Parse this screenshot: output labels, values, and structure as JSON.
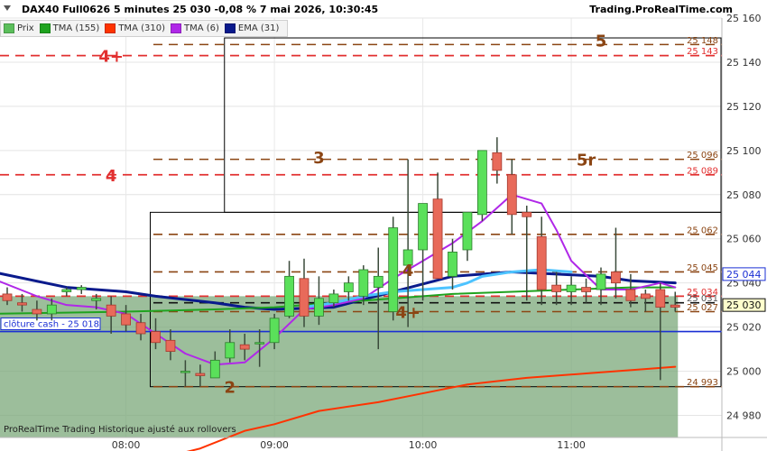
{
  "header": {
    "title": "DAX40 Full0626 5 minutes 25 030 -0,08 % 7 mai 2026, 10:30:45",
    "source": "Trading.ProRealTime.com"
  },
  "legend": [
    {
      "label": "Prix",
      "color": "#5bbf5b"
    },
    {
      "label": "TMA (155)",
      "color": "#1fa31f"
    },
    {
      "label": "TMA (310)",
      "color": "#ff3300"
    },
    {
      "label": "TMA (6)",
      "color": "#b028e8"
    },
    {
      "label": "EMA (31)",
      "color": "#0a1a8c"
    }
  ],
  "watermark": "ProRealTime Trading  Historique ajusté aux rollovers",
  "chart_data": {
    "type": "candlestick",
    "ylim": [
      24970,
      25160
    ],
    "y_ticks": [
      24980,
      25000,
      25020,
      25040,
      25060,
      25080,
      25100,
      25120,
      25140,
      25160
    ],
    "y_tick_labels": [
      "24 980",
      "25 000",
      "25 020",
      "25 040",
      "25 060",
      "25 080",
      "25 100",
      "25 120",
      "25 140",
      "25 160"
    ],
    "x_range": [
      0,
      50
    ],
    "x_ticks": [
      {
        "x": 8,
        "label": "08:00"
      },
      {
        "x": 18,
        "label": "09:00"
      },
      {
        "x": 28,
        "label": "10:00"
      },
      {
        "x": 38,
        "label": "11:00"
      }
    ],
    "candles": [
      [
        0,
        25035,
        25038,
        25030,
        25032
      ],
      [
        1,
        25031,
        25035,
        25027,
        25030
      ],
      [
        2,
        25028,
        25032,
        25023,
        25026
      ],
      [
        3,
        25026,
        25033,
        25023,
        25030
      ],
      [
        4,
        25036,
        25038,
        25034,
        25037
      ],
      [
        5,
        25037,
        25039,
        25035,
        25038
      ],
      [
        6,
        25032,
        25035,
        25028,
        25033
      ],
      [
        7,
        25030,
        25034,
        25017,
        25025
      ],
      [
        8,
        25026,
        25030,
        25018,
        25021
      ],
      [
        9,
        25022,
        25026,
        25014,
        25017
      ],
      [
        10,
        25018,
        25024,
        25010,
        25013
      ],
      [
        11,
        25014,
        25019,
        25005,
        25009
      ],
      [
        12,
        25000,
        25005,
        24993,
        25000
      ],
      [
        13,
        24999,
        25003,
        24993,
        24998
      ],
      [
        14,
        24997,
        25009,
        24997,
        25005
      ],
      [
        15,
        25006,
        25019,
        25004,
        25013
      ],
      [
        16,
        25012,
        25017,
        25005,
        25010
      ],
      [
        17,
        25013,
        25019,
        25002,
        25013
      ],
      [
        18,
        25013,
        25026,
        25010,
        25024
      ],
      [
        19,
        25025,
        25050,
        25024,
        25043
      ],
      [
        20,
        25042,
        25051,
        25020,
        25025
      ],
      [
        21,
        25025,
        25043,
        25021,
        25033
      ],
      [
        22,
        25031,
        25037,
        25029,
        25035
      ],
      [
        23,
        25036,
        25043,
        25032,
        25040
      ],
      [
        24,
        25034,
        25048,
        25030,
        25046
      ],
      [
        25,
        25038,
        25056,
        25010,
        25043
      ],
      [
        26,
        25027,
        25070,
        25023,
        25065
      ],
      [
        27,
        25048,
        25096,
        25020,
        25055
      ],
      [
        28,
        25055,
        25075,
        25032,
        25076
      ],
      [
        29,
        25078,
        25090,
        25055,
        25042
      ],
      [
        30,
        25043,
        25060,
        25037,
        25054
      ],
      [
        31,
        25055,
        25072,
        25050,
        25072
      ],
      [
        32,
        25071,
        25085,
        25068,
        25100
      ],
      [
        33,
        25099,
        25106,
        25085,
        25091
      ],
      [
        34,
        25089,
        25096,
        25062,
        25071
      ],
      [
        35,
        25072,
        25075,
        25032,
        25070
      ],
      [
        36,
        25061,
        25070,
        25030,
        25037
      ],
      [
        37,
        25039,
        25045,
        25030,
        25036
      ],
      [
        38,
        25036,
        25043,
        25030,
        25039
      ],
      [
        39,
        25038,
        25042,
        25031,
        25036
      ],
      [
        40,
        25037,
        25047,
        25030,
        25044
      ],
      [
        41,
        25045,
        25065,
        25033,
        25040
      ],
      [
        42,
        25037,
        25044,
        25029,
        25032
      ],
      [
        43,
        25035,
        25037,
        25027,
        25033
      ],
      [
        44,
        25037,
        25040,
        24996,
        25029
      ],
      [
        45,
        25030,
        25036,
        25027,
        25029
      ]
    ],
    "series": [
      {
        "name": "EMA (31)",
        "color": "#0a1a8c",
        "width": 3,
        "x": [
          -1,
          4,
          8,
          10,
          14,
          16,
          18,
          22,
          26,
          30,
          34,
          37,
          40,
          42,
          45
        ],
        "y": [
          25045,
          25038,
          25036,
          25034,
          25031,
          25029,
          25028,
          25029,
          25036,
          25043,
          25045,
          25044,
          25043,
          25041,
          25040
        ]
      },
      {
        "name": "TMA (155)",
        "color": "#1fa31f",
        "width": 2,
        "x": [
          -1,
          8,
          14,
          18,
          22,
          26,
          30,
          34,
          38,
          42,
          45
        ],
        "y": [
          25026,
          25027,
          25028,
          25029,
          25031,
          25033,
          25035,
          25036,
          25037,
          25038,
          25038
        ]
      },
      {
        "name": "TMA (310)",
        "color": "#ff3300",
        "width": 2,
        "x": [
          10,
          13,
          16,
          18,
          21,
          25,
          28,
          31,
          35,
          39,
          43,
          45
        ],
        "y": [
          24960,
          24965,
          24973,
          24976,
          24982,
          24986,
          24990,
          24994,
          24997,
          24999,
          25001,
          25002
        ]
      },
      {
        "name": "TMA (6)",
        "color": "#b028e8",
        "width": 2,
        "x": [
          -1,
          2,
          4,
          6,
          8,
          10,
          12,
          14,
          16,
          18,
          20,
          22,
          24,
          26,
          28,
          30,
          32,
          34,
          36,
          37,
          38,
          40,
          42,
          44,
          45
        ],
        "y": [
          25042,
          25034,
          25030,
          25029,
          25026,
          25017,
          25008,
          25003,
          25004,
          25015,
          25028,
          25030,
          25033,
          25042,
          25050,
          25058,
          25068,
          25080,
          25076,
          25064,
          25050,
          25037,
          25037,
          25040,
          25038
        ]
      },
      {
        "name": "cyan",
        "color": "#4dc3ff",
        "width": 3,
        "x": [
          20,
          22,
          24,
          26,
          28,
          30,
          31,
          32,
          34,
          36,
          38
        ],
        "y": [
          25029,
          25031,
          25034,
          25036,
          25037,
          25038,
          25040,
          25043,
          25045,
          25046,
          25045
        ]
      }
    ],
    "h_levels": [
      {
        "y": 25148,
        "color": "#8b4513",
        "dash": "dashed",
        "label": "25 148"
      },
      {
        "y": 25143,
        "color": "#e23030",
        "dash": "dashed",
        "label": "25 143"
      },
      {
        "y": 25096,
        "color": "#8b4513",
        "dash": "dashed",
        "label": "25 096"
      },
      {
        "y": 25089,
        "color": "#e23030",
        "dash": "dashed",
        "label": "25 089"
      },
      {
        "y": 25062,
        "color": "#8b4513",
        "dash": "dashed",
        "label": "25 062"
      },
      {
        "y": 25045,
        "color": "#8b4513",
        "dash": "dashed",
        "label": "25 045"
      },
      {
        "y": 25034,
        "color": "#e23030",
        "dash": "dashed",
        "label": "25 034"
      },
      {
        "y": 25031,
        "color": "#111111",
        "dash": "dashed",
        "label": "25 031"
      },
      {
        "y": 25027,
        "color": "#8b4513",
        "dash": "dashed",
        "label": "25 027"
      },
      {
        "y": 24993,
        "color": "#8b4513",
        "dash": "dashed",
        "label": "24 993"
      }
    ],
    "close_line": {
      "y": 25018,
      "label": "clôture cash -  25 018",
      "color": "#1a2fd4"
    },
    "boxes": [
      {
        "x0": 10,
        "x1": 50,
        "y0": 24993,
        "y1": 25072
      },
      {
        "x0": 15,
        "x1": 50,
        "y0": 25072,
        "y1": 25151
      }
    ],
    "shaded": {
      "x0": -1,
      "x1": 45,
      "y0": 24970,
      "y1": 25034
    },
    "annotations": [
      {
        "text": "4+",
        "x": 7,
        "y": 25143,
        "color": "#e23030"
      },
      {
        "text": "4",
        "x": 7,
        "y": 25089,
        "color": "#e23030"
      },
      {
        "text": "3",
        "x": 21,
        "y": 25097,
        "color": "#8b4513"
      },
      {
        "text": "5",
        "x": 40,
        "y": 25150,
        "color": "#8b4513"
      },
      {
        "text": "5r",
        "x": 39,
        "y": 25096,
        "color": "#8b4513"
      },
      {
        "text": "4",
        "x": 27,
        "y": 25046,
        "color": "#8b4513"
      },
      {
        "text": "4+",
        "x": 27,
        "y": 25027,
        "color": "#8b4513"
      },
      {
        "text": "2",
        "x": 15,
        "y": 24993,
        "color": "#8b4513"
      }
    ],
    "price_tags": [
      {
        "y": 25044,
        "label": "25 044",
        "bg": "#ffffff",
        "fg": "#1a2fd4",
        "border": "#1a2fd4"
      },
      {
        "y": 25030,
        "label": "25 030",
        "bg": "#ffffcc",
        "fg": "#111111",
        "border": "#111111"
      }
    ]
  }
}
